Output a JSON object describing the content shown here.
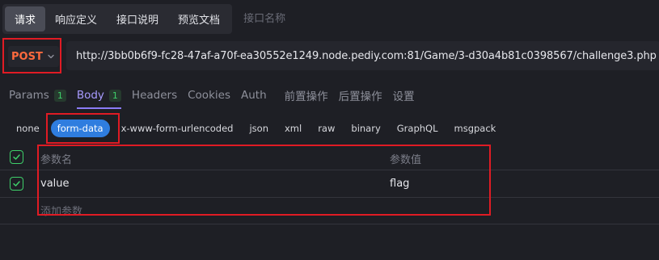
{
  "top_tabs": [
    "请求",
    "响应定义",
    "接口说明",
    "预览文档"
  ],
  "name_placeholder": "接口名称",
  "method": "POST",
  "url": "http://3bb0b6f9-fc28-47af-a70f-ea30552e1249.node.pediy.com:81/Game/3-d30a4b81c0398567/challenge3.php",
  "request_tabs": [
    {
      "label": "Params",
      "count": "1"
    },
    {
      "label": "Body",
      "count": "1"
    },
    {
      "label": "Headers"
    },
    {
      "label": "Cookies"
    },
    {
      "label": "Auth"
    },
    {
      "label": "前置操作"
    },
    {
      "label": "后置操作"
    },
    {
      "label": "设置"
    }
  ],
  "body_types": [
    "none",
    "form-data",
    "x-www-form-urlencoded",
    "json",
    "xml",
    "raw",
    "binary",
    "GraphQL",
    "msgpack"
  ],
  "selected_body_type": "form-data",
  "table": {
    "key_header": "参数名",
    "value_header": "参数值",
    "rows": [
      {
        "key": "value",
        "value": "flag",
        "enabled": true
      }
    ],
    "add_placeholder": "添加参数"
  },
  "colors": {
    "method": "#ff6a3d",
    "accent": "#8b7cf6",
    "selected_pill": "#2f7ddf",
    "check": "#3ecf6a",
    "highlight": "#e01b24"
  }
}
